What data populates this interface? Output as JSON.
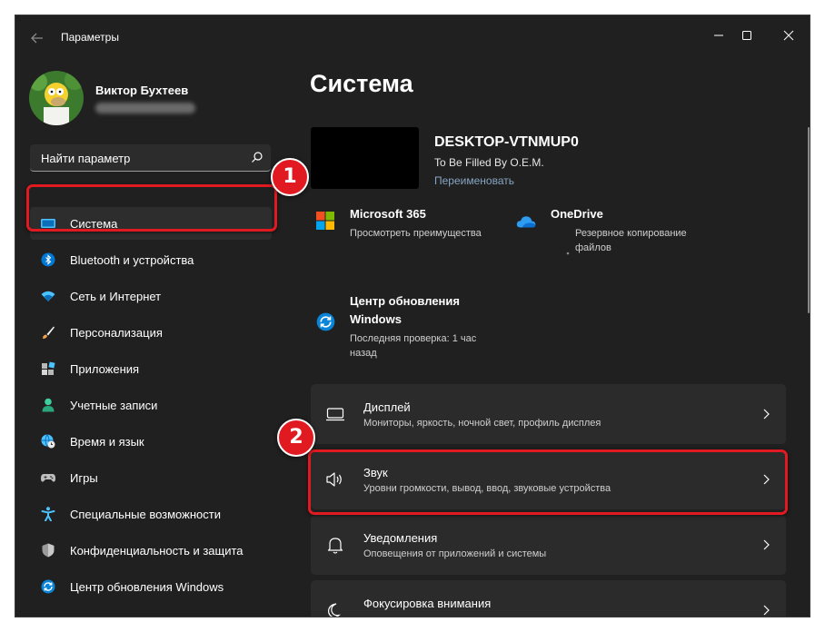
{
  "window": {
    "title": "Параметры"
  },
  "user": {
    "name": "Виктор Бухтеев"
  },
  "search": {
    "placeholder": "Найти параметр"
  },
  "sidebar": {
    "items": [
      {
        "label": "Система",
        "icon": "display-icon"
      },
      {
        "label": "Bluetooth и устройства",
        "icon": "bluetooth-icon"
      },
      {
        "label": "Сеть и Интернет",
        "icon": "wifi-icon"
      },
      {
        "label": "Персонализация",
        "icon": "brush-icon"
      },
      {
        "label": "Приложения",
        "icon": "apps-icon"
      },
      {
        "label": "Учетные записи",
        "icon": "person-icon"
      },
      {
        "label": "Время и язык",
        "icon": "globe-clock-icon"
      },
      {
        "label": "Игры",
        "icon": "gamepad-icon"
      },
      {
        "label": "Специальные возможности",
        "icon": "accessibility-icon"
      },
      {
        "label": "Конфиденциальность и защита",
        "icon": "shield-icon"
      },
      {
        "label": "Центр обновления Windows",
        "icon": "update-icon"
      }
    ],
    "active_index": 0
  },
  "main": {
    "title": "Система",
    "device": {
      "name": "DESKTOP-VTNMUP0",
      "model": "To Be Filled By O.E.M.",
      "rename": "Переименовать"
    },
    "tiles": [
      {
        "title": "Microsoft 365",
        "subtitle": "Просмотреть преимущества",
        "icon": "microsoft-logo-icon"
      },
      {
        "title": "OneDrive",
        "subtitle_line1": "Резервное копирование",
        "subtitle_line2": "файлов",
        "icon": "cloud-icon"
      },
      {
        "title_line1": "Центр обновления",
        "title_line2": "Windows",
        "subtitle_line1": "Последняя проверка: 1 час",
        "subtitle_line2": "назад",
        "icon": "update-icon"
      }
    ],
    "cards": [
      {
        "title": "Дисплей",
        "subtitle": "Мониторы, яркость, ночной свет, профиль дисплея",
        "icon": "monitor-icon"
      },
      {
        "title": "Звук",
        "subtitle": "Уровни громкости, вывод, ввод, звуковые устройства",
        "icon": "speaker-icon"
      },
      {
        "title": "Уведомления",
        "subtitle": "Оповещения от приложений и системы",
        "icon": "bell-icon"
      },
      {
        "title": "Фокусировка внимания",
        "subtitle": "",
        "icon": "moon-icon"
      }
    ]
  },
  "annotations": {
    "step1": "1",
    "step2": "2"
  },
  "colors": {
    "window_bg": "#202020",
    "card_bg": "#2b2b2b",
    "accent": "#4cc2ff",
    "highlight_red": "#e01a20",
    "link": "#87a5c2"
  }
}
